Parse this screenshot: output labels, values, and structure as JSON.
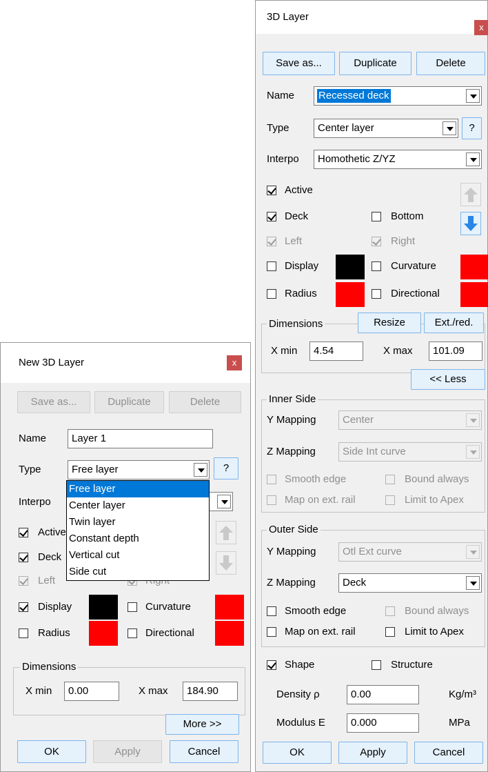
{
  "right_dialog": {
    "title": "3D Layer",
    "close_glyph": "x",
    "buttons": {
      "save_as": "Save as...",
      "duplicate": "Duplicate",
      "delete": "Delete"
    },
    "name_label": "Name",
    "name_value": "Recessed deck",
    "type_label": "Type",
    "type_value": "Center layer",
    "help_label": "?",
    "interpo_label": "Interpo",
    "interpo_value": "Homothetic Z/YZ",
    "active_label": "Active",
    "deck_label": "Deck",
    "bottom_label": "Bottom",
    "left_label": "Left",
    "right_label": "Right",
    "display_label": "Display",
    "curvature_label": "Curvature",
    "radius_label": "Radius",
    "directional_label": "Directional",
    "dimensions_title": "Dimensions",
    "resize_label": "Resize",
    "ext_red_label": "Ext./red.",
    "xmin_label": "X min",
    "xmin_value": "4.54",
    "xmax_label": "X max",
    "xmax_value": "101.09",
    "less_label": "<< Less",
    "inner_side": {
      "title": "Inner Side",
      "y_mapping_label": "Y Mapping",
      "y_mapping_value": "Center",
      "z_mapping_label": "Z Mapping",
      "z_mapping_value": "Side Int curve",
      "smooth_edge": "Smooth edge",
      "bound_always": "Bound always",
      "map_on_ext_rail": "Map on ext. rail",
      "limit_to_apex": "Limit to Apex"
    },
    "outer_side": {
      "title": "Outer Side",
      "y_mapping_label": "Y Mapping",
      "y_mapping_value": "Otl Ext curve",
      "z_mapping_label": "Z Mapping",
      "z_mapping_value": "Deck",
      "smooth_edge": "Smooth edge",
      "bound_always": "Bound always",
      "map_on_ext_rail": "Map on ext. rail",
      "limit_to_apex": "Limit to Apex"
    },
    "shape_label": "Shape",
    "structure_label": "Structure",
    "density_label": "Density ρ",
    "density_value": "0.00",
    "density_unit": "Kg/m³",
    "modulus_label": "Modulus E",
    "modulus_value": "0.000",
    "modulus_unit": "MPa",
    "ok": "OK",
    "apply": "Apply",
    "cancel": "Cancel"
  },
  "left_dialog": {
    "title": "New 3D Layer",
    "close_glyph": "x",
    "buttons": {
      "save_as": "Save as...",
      "duplicate": "Duplicate",
      "delete": "Delete"
    },
    "name_label": "Name",
    "name_value": "Layer 1",
    "type_label": "Type",
    "type_value": "Free layer",
    "help_label": "?",
    "interpo_label": "Interpo",
    "active_label": "Active",
    "deck_label": "Deck",
    "left_label": "Left",
    "right_label": "Right",
    "display_label": "Display",
    "curvature_label": "Curvature",
    "radius_label": "Radius",
    "directional_label": "Directional",
    "dimensions_title": "Dimensions",
    "xmin_label": "X min",
    "xmin_value": "0.00",
    "xmax_label": "X max",
    "xmax_value": "184.90",
    "more_label": "More >>",
    "ok": "OK",
    "apply": "Apply",
    "cancel": "Cancel",
    "type_dropdown": [
      "Free layer",
      "Center layer",
      "Twin layer",
      "Constant depth",
      "Vertical cut",
      "Side cut"
    ]
  },
  "colors": {
    "accent_blue": "#0078d7",
    "close_red": "#c94e4e",
    "swatch_black": "#000000",
    "swatch_red": "#ff0000",
    "button_blue_bg": "#e5f1fb"
  },
  "icons": {
    "up": "up-arrow-icon",
    "down": "down-arrow-icon"
  }
}
